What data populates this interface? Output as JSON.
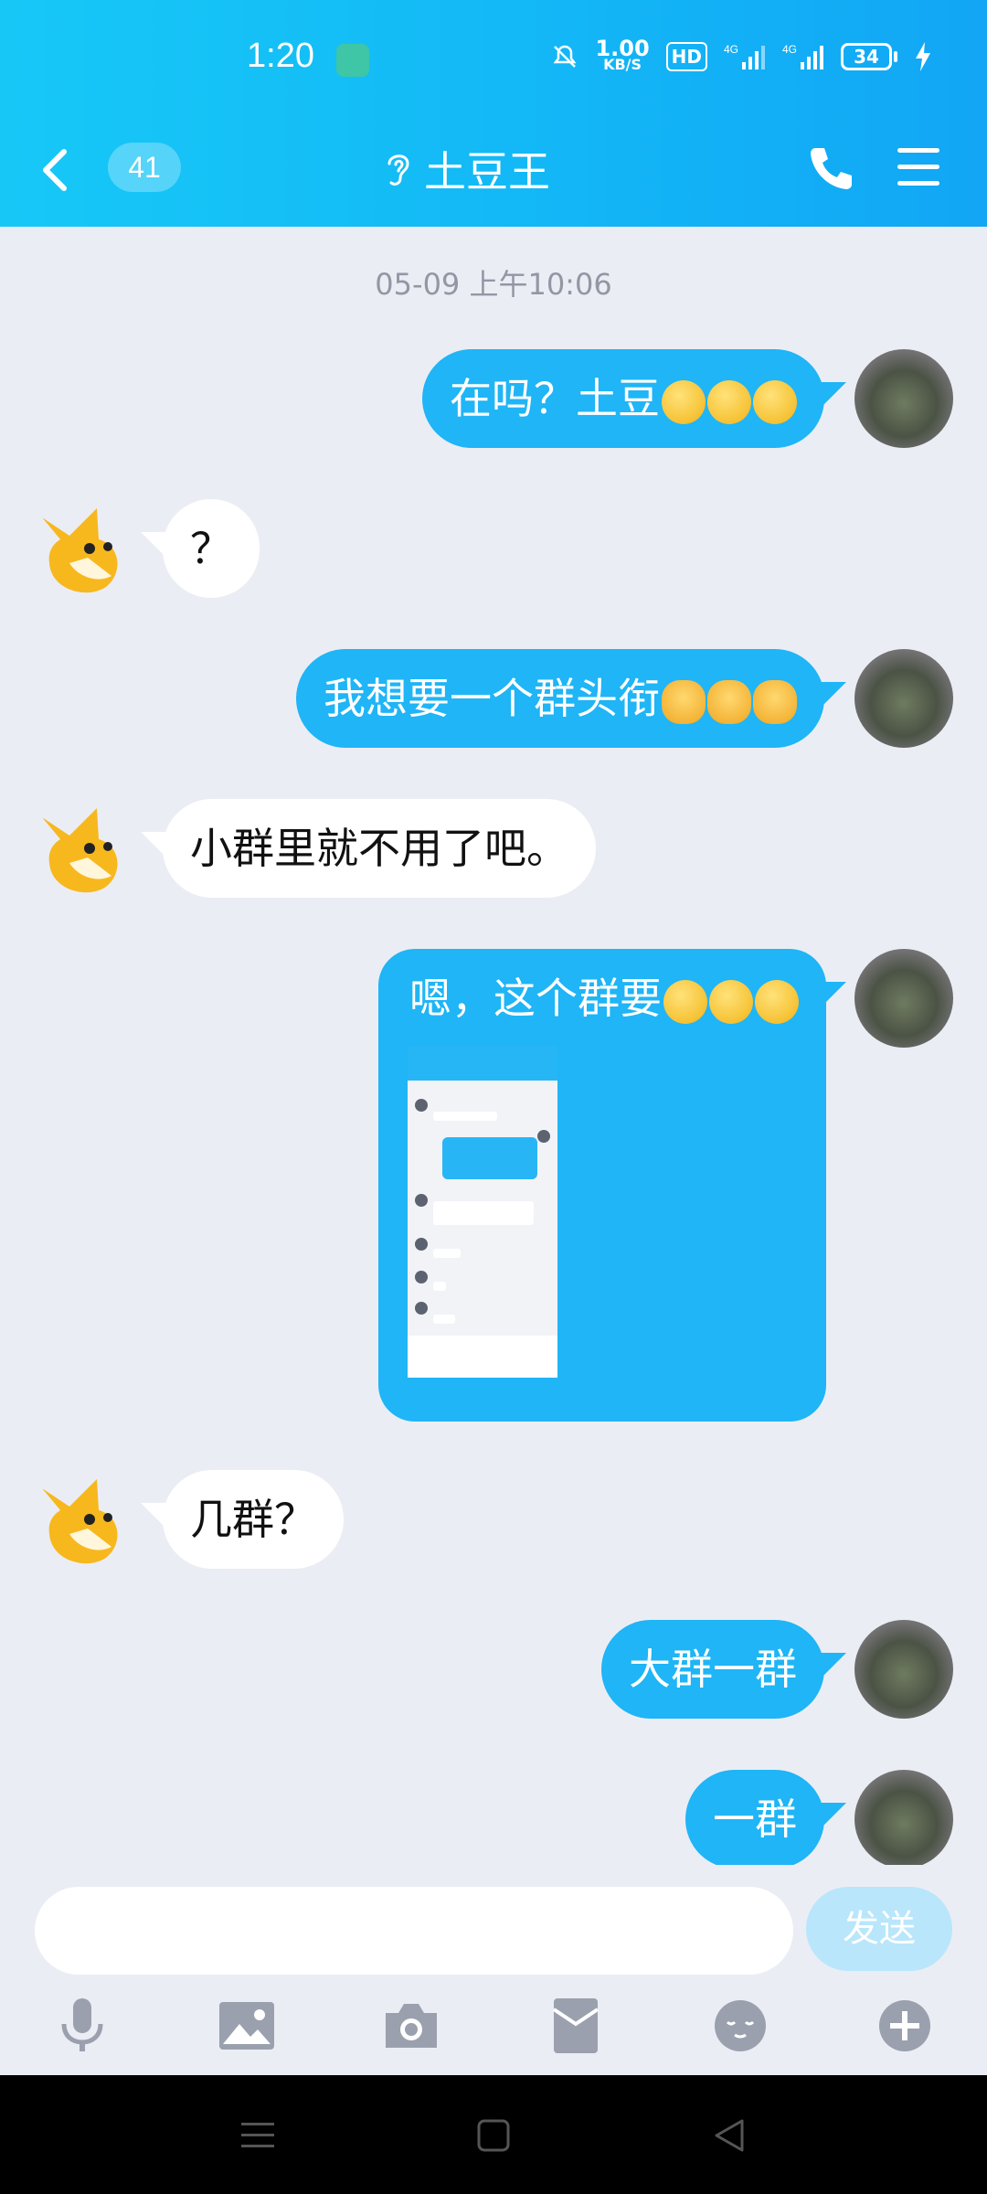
{
  "status": {
    "time": "1:20",
    "net_speed_value": "1.00",
    "net_speed_unit": "KB/S",
    "hd_label": "HD",
    "net1": "4G",
    "net2": "4G",
    "battery": "34"
  },
  "header": {
    "unread_count": "41",
    "title": "土豆王"
  },
  "chat": {
    "timestamp": "05-09 上午10:06",
    "messages": [
      {
        "sender": "me",
        "text": "在吗？土豆",
        "emoji": [
          "face",
          "face",
          "face"
        ]
      },
      {
        "sender": "other",
        "text": "？"
      },
      {
        "sender": "me",
        "text": "我想要一个群头衔",
        "emoji": [
          "cat",
          "cat",
          "cat"
        ]
      },
      {
        "sender": "other",
        "text": "小群里就不用了吧。"
      },
      {
        "sender": "me",
        "text": "嗯，这个群要",
        "emoji": [
          "dizzy",
          "dizzy",
          "dizzy"
        ],
        "has_image": true
      },
      {
        "sender": "other",
        "text": "几群？"
      },
      {
        "sender": "me",
        "text": "大群一群"
      },
      {
        "sender": "me",
        "text": "一群"
      }
    ]
  },
  "input": {
    "placeholder": "",
    "value": "",
    "send_label": "发送"
  },
  "toolbar": {
    "icons": [
      "microphone-icon",
      "image-icon",
      "camera-icon",
      "red-packet-icon",
      "emoji-icon",
      "plus-icon"
    ]
  },
  "colors": {
    "header_start": "#17c8f7",
    "header_end": "#12a6f5",
    "bubble_mine": "#1fb5f6",
    "bubble_theirs": "#ffffff",
    "chat_bg": "#ebedf5",
    "send_disabled": "#b9e6fb"
  }
}
